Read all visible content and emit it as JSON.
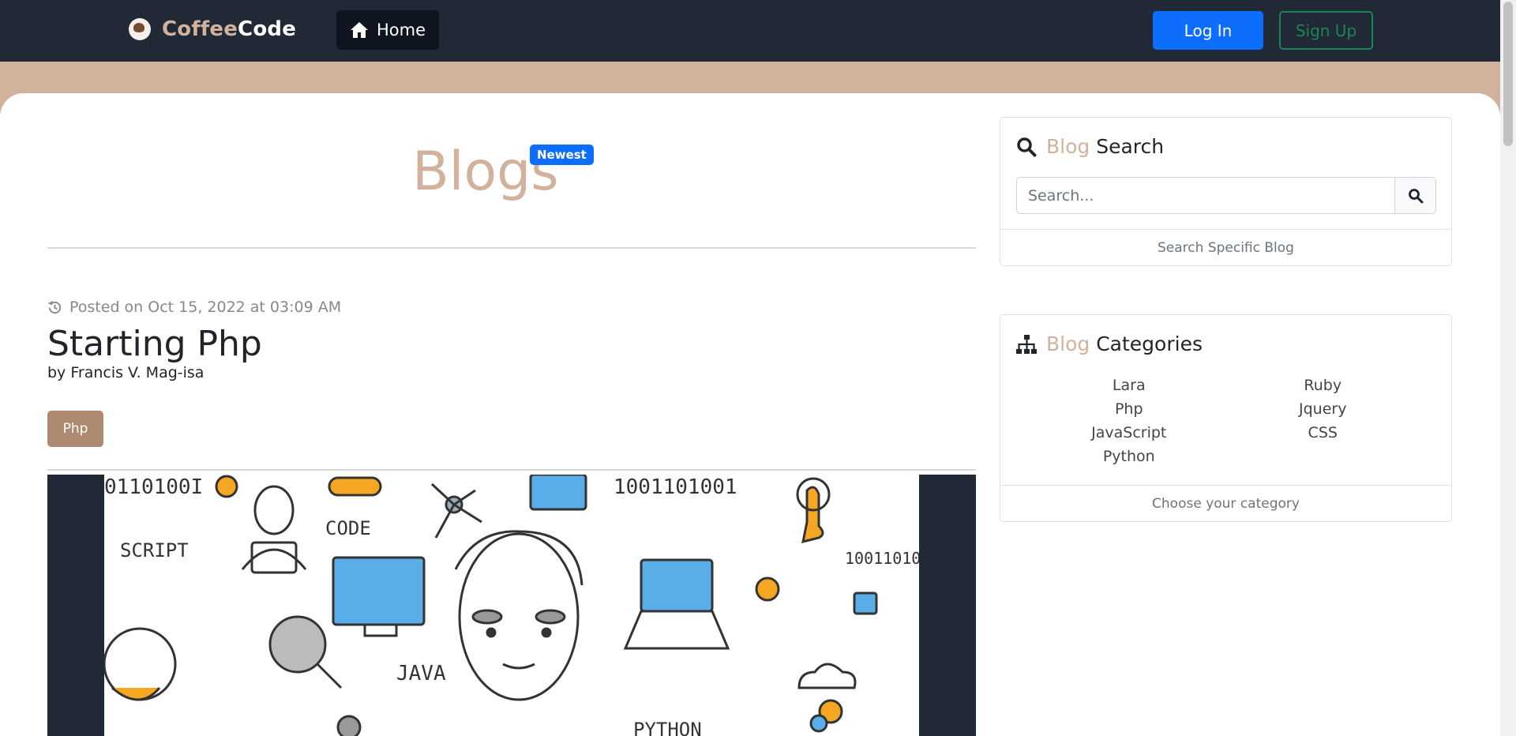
{
  "navbar": {
    "brand_part1": "Coffee",
    "brand_part2": "Code",
    "home_label": "Home",
    "login_label": "Log In",
    "signup_label": "Sign Up"
  },
  "blogs": {
    "heading": "Blogs",
    "badge": "Newest"
  },
  "post": {
    "posted_on": "Posted on Oct 15, 2022 at 03:09 AM",
    "title": "Starting Php",
    "author": "by Francis V. Mag-isa",
    "tag": "Php",
    "image_words": [
      "CODE",
      "SCRIPT",
      "JAVA",
      "PYTHON",
      "0110100I",
      "1001101001",
      "10011010"
    ]
  },
  "sidebar": {
    "search": {
      "title_accent": "Blog",
      "title_rest": "Search",
      "placeholder": "Search...",
      "footer": "Search Specific Blog"
    },
    "categories": {
      "title_accent": "Blog",
      "title_rest": "Categories",
      "left": [
        "Lara",
        "Php",
        "JavaScript",
        "Python"
      ],
      "right": [
        "Ruby",
        "Jquery",
        "CSS"
      ],
      "footer": "Choose your category"
    }
  },
  "colors": {
    "navbar": "#212836",
    "accent": "#d2b29d",
    "primary": "#0d6efd",
    "success": "#198754",
    "tag": "#ae8a71"
  },
  "icons": [
    "coffee-logo-icon",
    "home-icon",
    "history-icon",
    "search-icon",
    "sitemap-icon"
  ]
}
